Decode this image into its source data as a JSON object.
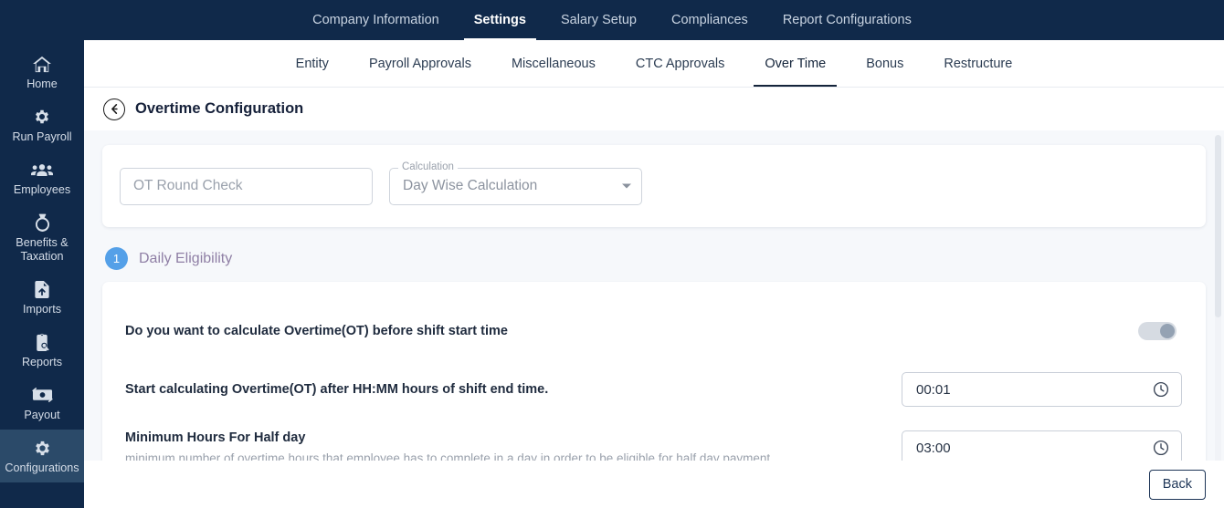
{
  "topnav": {
    "items": [
      {
        "label": "Company Information",
        "active": false
      },
      {
        "label": "Settings",
        "active": true
      },
      {
        "label": "Salary Setup",
        "active": false
      },
      {
        "label": "Compliances",
        "active": false
      },
      {
        "label": "Report Configurations",
        "active": false
      }
    ]
  },
  "sidebar": {
    "items": [
      {
        "label": "Home",
        "icon": "home-icon",
        "active": false
      },
      {
        "label": "Run Payroll",
        "icon": "gear-icon",
        "active": false
      },
      {
        "label": "Employees",
        "icon": "people-icon",
        "active": false
      },
      {
        "label": "Benefits & Taxation",
        "icon": "money-bag-icon",
        "active": false
      },
      {
        "label": "Imports",
        "icon": "file-upload-icon",
        "active": false
      },
      {
        "label": "Reports",
        "icon": "report-search-icon",
        "active": false
      },
      {
        "label": "Payout",
        "icon": "cash-exchange-icon",
        "active": false
      },
      {
        "label": "Configurations",
        "icon": "gear-icon",
        "active": true
      }
    ]
  },
  "subnav": {
    "items": [
      {
        "label": "Entity",
        "active": false
      },
      {
        "label": "Payroll Approvals",
        "active": false
      },
      {
        "label": "Miscellaneous",
        "active": false
      },
      {
        "label": "CTC Approvals",
        "active": false
      },
      {
        "label": "Over Time",
        "active": true
      },
      {
        "label": "Bonus",
        "active": false
      },
      {
        "label": "Restructure",
        "active": false
      }
    ]
  },
  "page": {
    "title": "Overtime Configuration",
    "back_icon": "circle-arrow-left-icon"
  },
  "top_card": {
    "ot_round_check": {
      "placeholder": "OT Round Check",
      "value": ""
    },
    "calculation": {
      "label": "Calculation",
      "value": "Day Wise Calculation",
      "caret_icon": "chevron-down-icon"
    }
  },
  "step": {
    "number": "1",
    "title": "Daily Eligibility"
  },
  "rows": [
    {
      "label": "Do you want to calculate Overtime(OT) before shift start time",
      "sub": "",
      "control": "toggle",
      "toggle_on": false
    },
    {
      "label": "Start calculating Overtime(OT) after HH:MM hours of shift end time.",
      "sub": "",
      "control": "time",
      "value": "00:01",
      "icon": "clock-icon"
    },
    {
      "label": "Minimum Hours For Half day",
      "sub": "minimum number of overtime hours that employee has to complete in a day in order to be eligible for half day payment",
      "control": "time",
      "value": "03:00",
      "icon": "clock-icon"
    }
  ],
  "footer": {
    "back_label": "Back"
  },
  "colors": {
    "navy": "#10294a",
    "sidebar_active": "#2b4a69",
    "page_bg": "#f6f8fb",
    "step_badge": "#54a0e8",
    "step_title": "#8f7fa5",
    "button_border": "#1d3557"
  }
}
